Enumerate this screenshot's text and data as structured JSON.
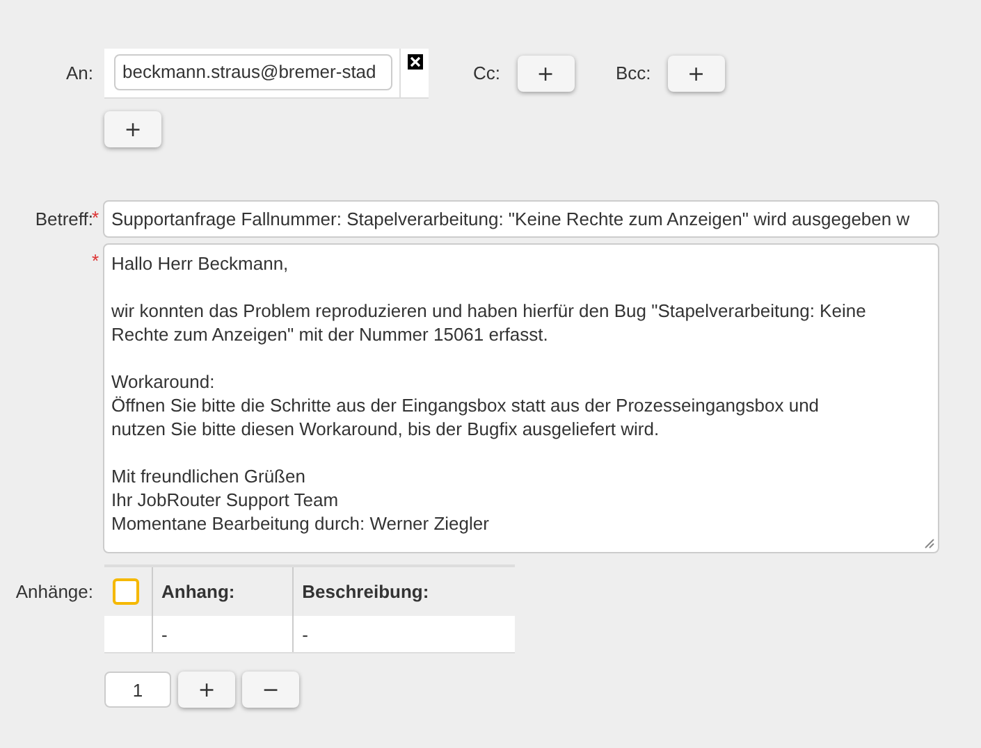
{
  "to": {
    "label": "An:",
    "recipients": [
      {
        "value": "beckmann.straus@bremer-stad"
      }
    ],
    "add_button": "+"
  },
  "cc": {
    "label": "Cc:",
    "add_button": "+"
  },
  "bcc": {
    "label": "Bcc:",
    "add_button": "+"
  },
  "subject": {
    "label": "Betreff:",
    "required_mark": "*",
    "value": "Supportanfrage Fallnummer: Stapelverarbeitung: \"Keine Rechte zum Anzeigen\" wird ausgegeben w"
  },
  "message": {
    "required_mark": "*",
    "value": "Hallo Herr Beckmann,\n\nwir konnten das Problem reproduzieren und haben hierfür den Bug \"Stapelverarbeitung: Keine\nRechte zum Anzeigen\" mit der Nummer 15061 erfasst.\n\nWorkaround:\nÖffnen Sie bitte die Schritte aus der Eingangsbox statt aus der Prozesseingangsbox und\nnutzen Sie bitte diesen Workaround, bis der Bugfix ausgeliefert wird.\n\nMit freundlichen Grüßen\nIhr JobRouter Support Team\nMomentane Bearbeitung durch: Werner Ziegler"
  },
  "attachments": {
    "label": "Anhänge:",
    "select_all_checked": false,
    "columns": [
      "Anhang:",
      "Beschreibung:"
    ],
    "rows": [
      {
        "cells": [
          "-",
          "-"
        ]
      }
    ],
    "row_count": "1",
    "add_button": "+",
    "remove_button": "−"
  }
}
